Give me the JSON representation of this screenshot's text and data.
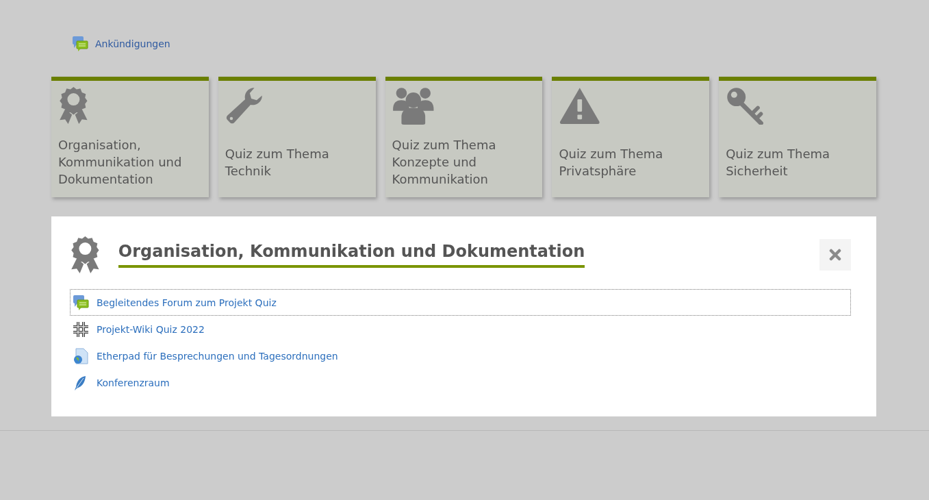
{
  "announcements": {
    "label": "Ankündigungen"
  },
  "tiles": [
    {
      "kind": "ribbon",
      "title": "Organisation, Kommunikation und Dokumentation"
    },
    {
      "kind": "wrench",
      "title": "Quiz zum Thema Technik"
    },
    {
      "kind": "people",
      "title": "Quiz zum Thema Konzepte und Kommunikation"
    },
    {
      "kind": "warning",
      "title": "Quiz zum Thema Privatsphäre"
    },
    {
      "kind": "key",
      "title": "Quiz zum Thema Sicherheit"
    }
  ],
  "section": {
    "kind": "ribbon",
    "title": "Organisation, Kommunikation und Dokumentation",
    "activities": [
      {
        "kind": "forum",
        "label": "Begleitendes Forum zum Projekt Quiz",
        "focused": true
      },
      {
        "kind": "wiki",
        "label": "Projekt-Wiki Quiz 2022",
        "focused": false
      },
      {
        "kind": "page",
        "label": "Etherpad für Besprechungen und Tagesordnungen",
        "focused": false
      },
      {
        "kind": "chat",
        "label": "Konferenzraum",
        "focused": false
      }
    ]
  }
}
